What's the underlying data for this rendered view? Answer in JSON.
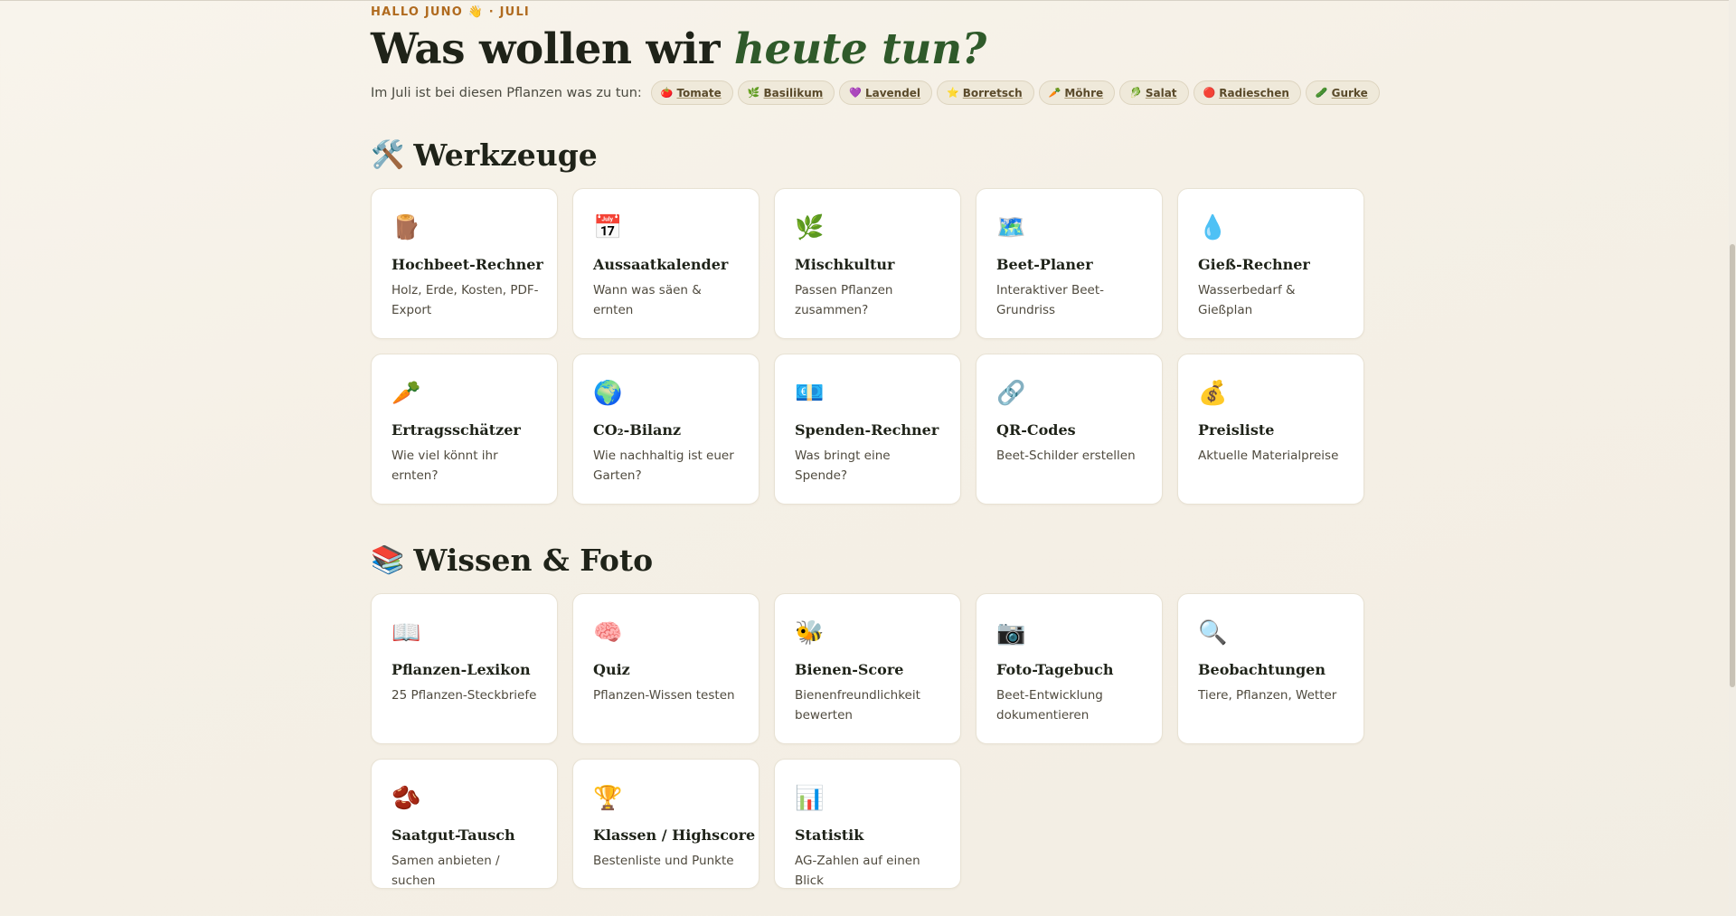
{
  "header": {
    "greeting": "HALLO JUNO 👋 · JULI",
    "headline_plain": "Was wollen wir ",
    "headline_accent": "heute tun?",
    "plants_label": "Im Juli ist bei diesen Pflanzen was zu tun:",
    "plants": [
      {
        "icon": "🍅",
        "label": "Tomate"
      },
      {
        "icon": "🌿",
        "label": "Basilikum"
      },
      {
        "icon": "💜",
        "label": "Lavendel"
      },
      {
        "icon": "⭐",
        "label": "Borretsch"
      },
      {
        "icon": "🥕",
        "label": "Möhre"
      },
      {
        "icon": "🥬",
        "label": "Salat"
      },
      {
        "icon": "🔴",
        "label": "Radieschen"
      },
      {
        "icon": "🥒",
        "label": "Gurke"
      }
    ]
  },
  "tools_section": {
    "icon": "🛠️",
    "title": "Werkzeuge",
    "cards": [
      {
        "icon": "🪵",
        "title": "Hochbeet-Rechner",
        "desc": "Holz, Erde, Kosten, PDF-Export"
      },
      {
        "icon": "📅",
        "title": "Aussaatkalender",
        "desc": "Wann was säen & ernten"
      },
      {
        "icon": "🌿",
        "title": "Mischkultur",
        "desc": "Passen Pflanzen zusammen?"
      },
      {
        "icon": "🗺️",
        "title": "Beet-Planer",
        "desc": "Interaktiver Beet-Grundriss"
      },
      {
        "icon": "💧",
        "title": "Gieß-Rechner",
        "desc": "Wasserbedarf & Gießplan"
      },
      {
        "icon": "🥕",
        "title": "Ertragsschätzer",
        "desc": "Wie viel könnt ihr ernten?"
      },
      {
        "icon": "🌍",
        "title": "CO₂-Bilanz",
        "desc": "Wie nachhaltig ist euer Garten?"
      },
      {
        "icon": "💶",
        "title": "Spenden-Rechner",
        "desc": "Was bringt eine Spende?"
      },
      {
        "icon": "🔗",
        "title": "QR-Codes",
        "desc": "Beet-Schilder erstellen"
      },
      {
        "icon": "💰",
        "title": "Preisliste",
        "desc": "Aktuelle Materialpreise"
      }
    ]
  },
  "knowledge_section": {
    "icon": "📚",
    "title": "Wissen & Foto",
    "cards": [
      {
        "icon": "📖",
        "title": "Pflanzen-Lexikon",
        "desc": "25 Pflanzen-Steckbriefe"
      },
      {
        "icon": "🧠",
        "title": "Quiz",
        "desc": "Pflanzen-Wissen testen"
      },
      {
        "icon": "🐝",
        "title": "Bienen-Score",
        "desc": "Bienenfreundlichkeit bewerten"
      },
      {
        "icon": "📷",
        "title": "Foto-Tagebuch",
        "desc": "Beet-Entwicklung dokumentieren"
      },
      {
        "icon": "🔍",
        "title": "Beobachtungen",
        "desc": "Tiere, Pflanzen, Wetter"
      },
      {
        "icon": "🫘",
        "title": "Saatgut-Tausch",
        "desc": "Samen anbieten / suchen"
      },
      {
        "icon": "🏆",
        "title": "Klassen / Highscore",
        "desc": "Bestenliste und Punkte"
      },
      {
        "icon": "📊",
        "title": "Statistik",
        "desc": "AG-Zahlen auf einen Blick"
      }
    ]
  },
  "icon_names": {
    "tools": [
      "log-icon",
      "calendar-icon",
      "herb-icon",
      "map-icon",
      "droplet-icon",
      "carrot-icon",
      "globe-icon",
      "money-icon",
      "link-icon",
      "moneybag-icon"
    ],
    "knowledge": [
      "book-icon",
      "brain-icon",
      "bee-icon",
      "camera-icon",
      "magnifier-icon",
      "beans-icon",
      "trophy-icon",
      "chart-icon"
    ],
    "plants": [
      "tomato-icon",
      "basil-icon",
      "heart-icon",
      "star-icon",
      "carrot-icon",
      "lettuce-icon",
      "radish-icon",
      "cucumber-icon"
    ]
  }
}
